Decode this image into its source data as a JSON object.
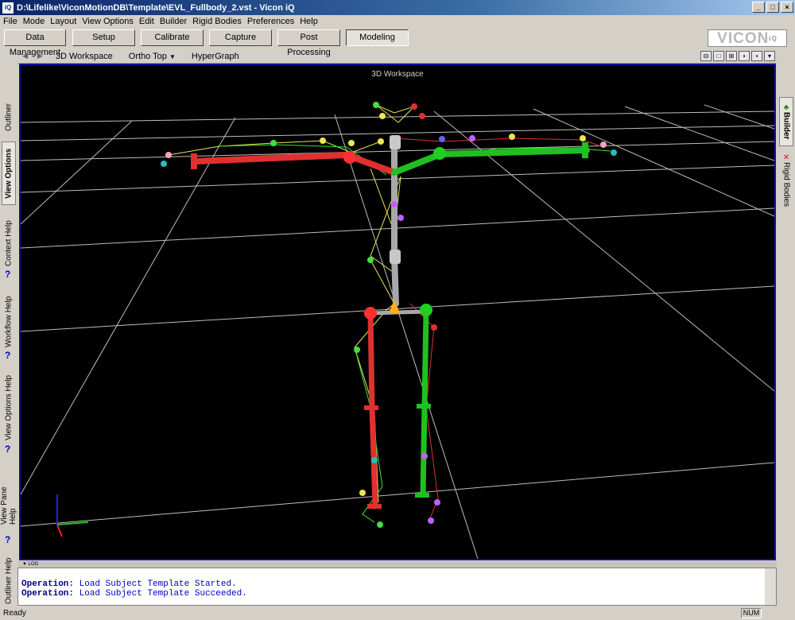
{
  "window": {
    "title": "D:\\Lifelike\\ViconMotionDB\\Template\\EVL_Fullbody_2.vst - Vicon iQ",
    "app_icon": "iQ",
    "buttons": [
      "_",
      "□",
      "×"
    ]
  },
  "menu": [
    "File",
    "Mode",
    "Layout",
    "View Options",
    "Edit",
    "Builder",
    "Rigid Bodies",
    "Preferences",
    "Help"
  ],
  "modes": {
    "items": [
      "Data Management",
      "Setup",
      "Calibrate",
      "Capture",
      "Post Processing",
      "Modeling"
    ],
    "active": "Modeling"
  },
  "logo": {
    "text": "VICON",
    "sub": "iQ"
  },
  "view_toolbar": {
    "items": [
      "3D Workspace",
      "Ortho Top",
      "HyperGraph"
    ],
    "ortho_dropdown_icon": "chevron-down-icon"
  },
  "left_tabs": [
    "Outliner",
    "View Options",
    "Context Help",
    "Workflow Help",
    "View Options Help",
    "View Pane Help",
    "Outliner Help"
  ],
  "left_help_mark": "?",
  "right_tabs": [
    "Builder",
    "Rigid Bodies"
  ],
  "viewport": {
    "title": "3D Workspace"
  },
  "log": {
    "header": "LOG",
    "lines": [
      {
        "label": "Operation:",
        "text": "Load Subject Template Started."
      },
      {
        "label": "Operation:",
        "text": "Load Subject Template Succeeded."
      }
    ]
  },
  "status": {
    "text": "Ready",
    "num": "NUM"
  },
  "colors": {
    "left_side": "#e03030",
    "right_side": "#20c020",
    "spine": "#a0a0a0",
    "grid": "#bdbdbd",
    "viewport_border": "#1010a0"
  }
}
